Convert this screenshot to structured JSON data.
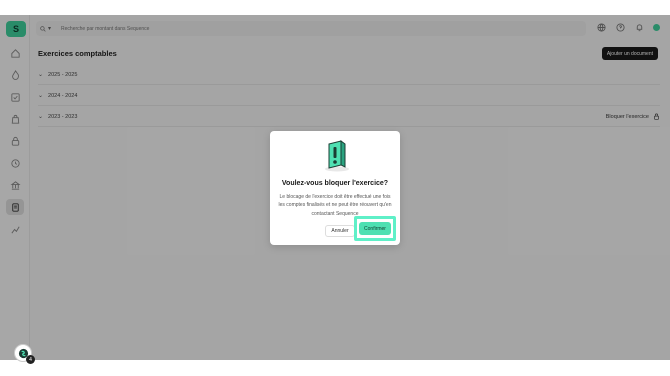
{
  "brand": {
    "logo_text": "S",
    "accent": "#3ecf9b"
  },
  "topbar": {
    "search_scope_icon": "search-icon",
    "search_placeholder": "Recherche par montant dans Sequence",
    "icons": [
      "globe-icon",
      "help-icon",
      "bell-icon",
      "user-avatar"
    ]
  },
  "sidebar": {
    "items": [
      "home-icon",
      "flame-icon",
      "check-square-icon",
      "bag-icon",
      "lock-icon",
      "clock-icon",
      "bank-icon",
      "document-icon",
      "chart-icon"
    ],
    "active_index": 7
  },
  "main": {
    "title": "Exercices comptables",
    "add_button": "Ajouter un document",
    "exercises": [
      {
        "label": "2025 - 2025"
      },
      {
        "label": "2024 - 2024"
      },
      {
        "label": "2023 - 2023",
        "action": "Bloquer l'exercice"
      }
    ]
  },
  "modal": {
    "title": "Voulez-vous bloquer l'exercice?",
    "text": "Le blocage de l'exercice doit être effectué une fois les comptes finalisés et ne peut être réouvert qu'en contactant Sequence",
    "cancel": "Annuler",
    "confirm": "Confirmer"
  },
  "widget": {
    "badge": "4"
  }
}
